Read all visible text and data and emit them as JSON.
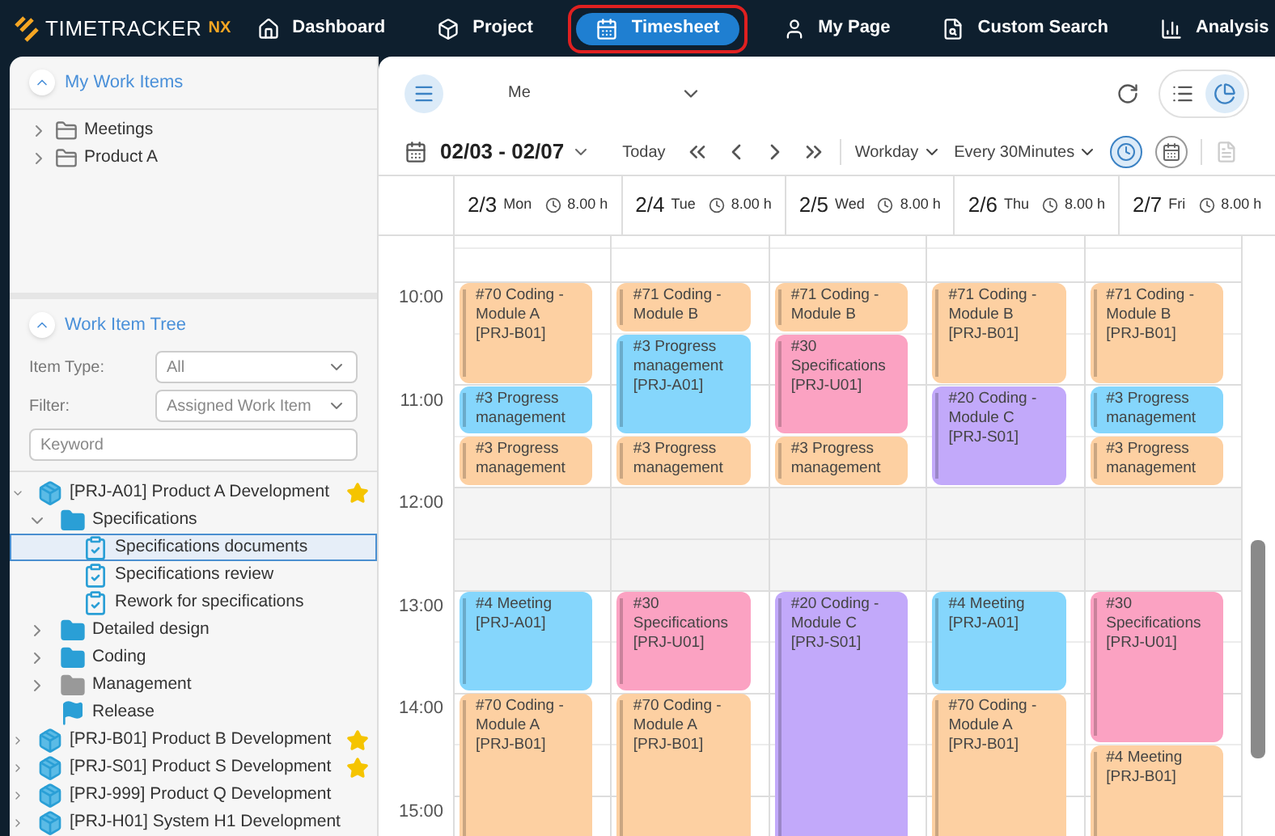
{
  "app": {
    "logo": "TIMETRACKER",
    "logo_suffix": "NX"
  },
  "nav": [
    {
      "label": "Dashboard",
      "selected": false
    },
    {
      "label": "Project",
      "selected": false
    },
    {
      "label": "Timesheet",
      "selected": true
    },
    {
      "label": "My Page",
      "selected": false
    },
    {
      "label": "Custom Search",
      "selected": false
    },
    {
      "label": "Analysis",
      "selected": false
    }
  ],
  "my_work_items": {
    "title": "My Work Items",
    "expanded": true,
    "items": [
      {
        "label": "Meetings",
        "expanded": false
      },
      {
        "label": "Product A",
        "expanded": false
      }
    ]
  },
  "work_item_tree": {
    "title": "Work Item Tree",
    "expanded": true,
    "item_type": {
      "label": "Item Type:",
      "value": "All"
    },
    "filter": {
      "label": "Filter:",
      "value": "Assigned Work Item"
    },
    "keyword": {
      "placeholder": "Keyword"
    },
    "items": [
      {
        "label": "[PRJ-A01] Product A Development",
        "kind": "project",
        "expanded": true,
        "starred": true,
        "selected": false,
        "children": [
          {
            "label": "Specifications",
            "kind": "task-folder",
            "expanded": true,
            "selected": false,
            "children": [
              {
                "label": "Specifications documents",
                "kind": "task",
                "selected": true
              },
              {
                "label": "Specifications review",
                "kind": "task",
                "selected": false
              },
              {
                "label": "Rework for specifications",
                "kind": "task",
                "selected": false
              }
            ]
          },
          {
            "label": "Detailed design",
            "kind": "task-folder",
            "expanded": false,
            "selected": false
          },
          {
            "label": "Coding",
            "kind": "folder",
            "expanded": false,
            "selected": false
          },
          {
            "label": "Management",
            "kind": "gray-folder",
            "expanded": false,
            "selected": false
          },
          {
            "label": "Release",
            "kind": "milestone",
            "selected": false
          }
        ]
      },
      {
        "label": "[PRJ-B01] Product B Development",
        "kind": "project",
        "expanded": false,
        "starred": true,
        "selected": false
      },
      {
        "label": "[PRJ-S01] Product S Development",
        "kind": "project",
        "expanded": false,
        "starred": true,
        "selected": false
      },
      {
        "label": "[PRJ-999] Product Q Development",
        "kind": "project",
        "expanded": false,
        "starred": false,
        "selected": false
      },
      {
        "label": "[PRJ-H01] System H1 Development",
        "kind": "project",
        "expanded": false,
        "starred": false,
        "selected": false
      }
    ]
  },
  "toolbar": {
    "user": "Me",
    "range": "02/03 - 02/07",
    "today": "Today",
    "days": "Workday",
    "interval": "Every 30Minutes",
    "time_view_selected": true,
    "chart_view_selected": true
  },
  "times": [
    "10:00",
    "11:00",
    "12:00",
    "13:00",
    "14:00",
    "15:00"
  ],
  "days": [
    {
      "date": "2/3",
      "weekday": "Mon",
      "hours": "8.00 h",
      "events": [
        {
          "title": "#70 Coding - Module A",
          "code": "[PRJ-B01]",
          "color": "#fdd0a2"
        },
        {
          "title": "#3 Progress management",
          "color": "#85d6fc"
        },
        {
          "title": "#3 Progress management",
          "color": "#fdd0a2"
        },
        {
          "title": "#4 Meeting",
          "code": "[PRJ-A01]",
          "color": "#85d6fc"
        },
        {
          "title": "#70 Coding - Module A",
          "code": "[PRJ-B01]",
          "color": "#fdd0a2"
        }
      ]
    },
    {
      "date": "2/4",
      "weekday": "Tue",
      "hours": "8.00 h",
      "events": [
        {
          "title": "#71 Coding - Module B",
          "color": "#fdd0a2"
        },
        {
          "title": "#3 Progress management",
          "code": "[PRJ-A01]",
          "color": "#85d6fc"
        },
        {
          "title": "#3 Progress management",
          "color": "#fdd0a2"
        },
        {
          "title": "#30 Specifications",
          "code": "[PRJ-U01]",
          "color": "#fba2c2"
        },
        {
          "title": "#70 Coding - Module A",
          "code": "[PRJ-B01]",
          "color": "#fdd0a2"
        }
      ]
    },
    {
      "date": "2/5",
      "weekday": "Wed",
      "hours": "8.00 h",
      "events": [
        {
          "title": "#71 Coding - Module B",
          "color": "#fdd0a2"
        },
        {
          "title": "#30 Specifications",
          "code": "[PRJ-U01]",
          "color": "#fba2c2"
        },
        {
          "title": "#3 Progress management",
          "color": "#fdd0a2"
        },
        {
          "title": "#20 Coding - Module C",
          "code": "[PRJ-S01]",
          "color": "#c2a9fa"
        }
      ]
    },
    {
      "date": "2/6",
      "weekday": "Thu",
      "hours": "8.00 h",
      "events": [
        {
          "title": "#71 Coding - Module B",
          "code": "[PRJ-B01]",
          "color": "#fdd0a2"
        },
        {
          "title": "#20 Coding - Module C",
          "code": "[PRJ-S01]",
          "color": "#c2a9fa"
        },
        {
          "title": "#4 Meeting",
          "code": "[PRJ-A01]",
          "color": "#85d6fc"
        },
        {
          "title": "#70 Coding - Module A",
          "code": "[PRJ-B01]",
          "color": "#fdd0a2"
        }
      ]
    },
    {
      "date": "2/7",
      "weekday": "Fri",
      "hours": "8.00 h",
      "events": [
        {
          "title": "#71 Coding - Module B",
          "code": "[PRJ-B01]",
          "color": "#fdd0a2"
        },
        {
          "title": "#3 Progress management",
          "color": "#85d6fc"
        },
        {
          "title": "#3 Progress management",
          "color": "#fdd0a2"
        },
        {
          "title": "#30 Specifications",
          "code": "[PRJ-U01]",
          "color": "#fba2c2"
        },
        {
          "title": "#4 Meeting",
          "code": "[PRJ-B01]",
          "color": "#fdd0a2"
        }
      ]
    }
  ]
}
